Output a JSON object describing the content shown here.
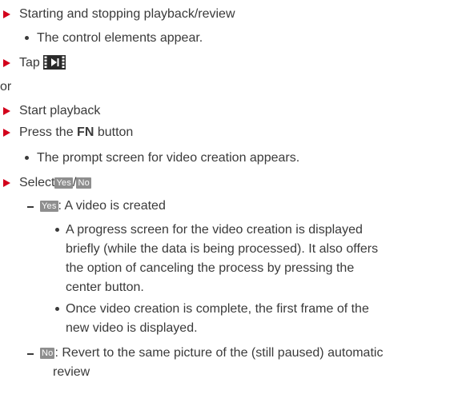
{
  "steps": {
    "s1": "Starting and stopping playback/review",
    "s1_sub": "The control elements appear.",
    "s2_prefix": "Tap",
    "or": "or",
    "s3": "Start playback",
    "s4_prefix": "Press the",
    "s4_bold": "FN",
    "s4_suffix": "button",
    "s4_sub": "The prompt screen for video creation appears.",
    "s5_prefix": "Select",
    "s5_sep": "/",
    "yes_tag": "Yes",
    "no_tag": "No",
    "yes_text": ": A video is created",
    "yes_b1_l1": "A progress screen for the video creation is displayed",
    "yes_b1_l2": "briefly (while the data is being processed). It also offers",
    "yes_b1_l3": "the option of canceling the process by pressing the",
    "yes_b1_l4": "center button.",
    "yes_b2_l1": "Once video creation is complete, the first frame of the",
    "yes_b2_l2": "new video is displayed.",
    "no_text_l1": ": Revert to the same picture of the (still paused) automatic",
    "no_text_l2": "review"
  },
  "icons": {
    "arrow": "red-triangle-bullet-icon",
    "film": "video-film-icon"
  },
  "colors": {
    "arrow": "#d3001b",
    "text": "#3a3a3a",
    "tag_bg": "#8e8e8e"
  }
}
